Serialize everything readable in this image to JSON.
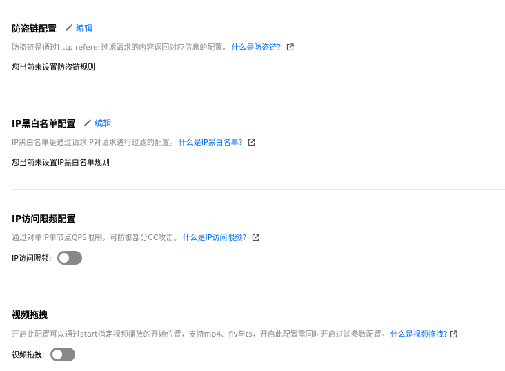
{
  "hotlink": {
    "title": "防盗链配置",
    "edit_label": "编辑",
    "desc": "防盗链是通过http referer过滤请求的内容返回对应信息的配置。",
    "link": "什么是防盗链?",
    "status": "您当前未设置防盗链规则"
  },
  "ip_list": {
    "title": "IP黑白名单配置",
    "edit_label": "编辑",
    "desc": "IP黑白名单是通过请求IP对请求进行过滤的配置。",
    "link": "什么是IP黑白名单?",
    "status": "您当前未设置IP黑白名单规则"
  },
  "ip_rate": {
    "title": "IP访问限频配置",
    "desc": "通过对单IP单节点QPS限制，可防御部分CC攻击。",
    "link": "什么是IP访问限频?",
    "toggle_label": "IP访问限频:",
    "toggle_on": false
  },
  "video_drag": {
    "title": "视频拖拽",
    "desc": "开启此配置可以通过start指定视频播放的开始位置，支持mp4、flv与ts，开启此配置需同时开启过滤参数配置。",
    "link": "什么是视频拖拽?",
    "toggle_label": "视频拖拽:",
    "toggle_on": false
  },
  "icons": {
    "edit": "pencil-icon",
    "external": "external-link-icon"
  },
  "colors": {
    "link": "#006eff",
    "desc": "#888888",
    "toggle_off": "#888888",
    "divider": "#e8e8e8"
  }
}
